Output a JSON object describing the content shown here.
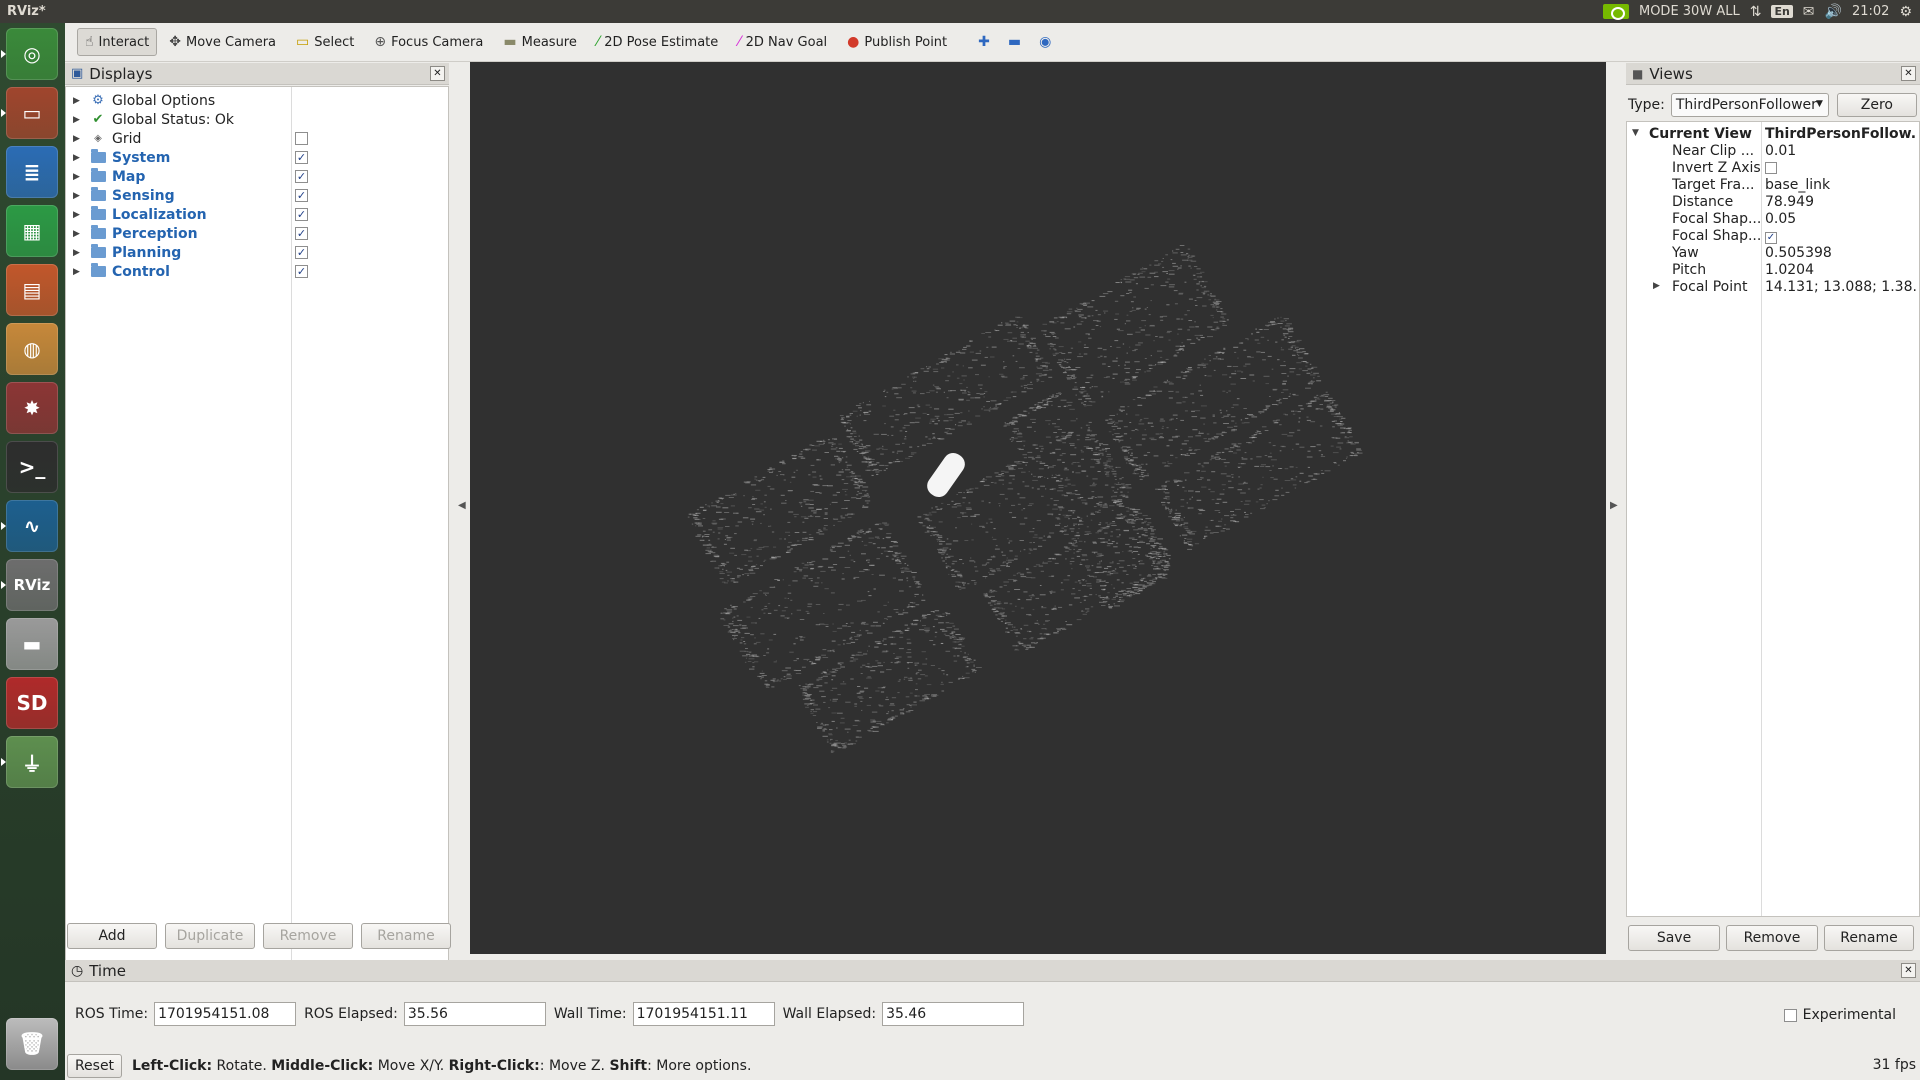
{
  "window": {
    "title": "RViz*"
  },
  "system_tray": {
    "power_mode": "MODE 30W ALL",
    "keyboard_layout": "En",
    "clock": "21:02"
  },
  "launcher": {
    "items": [
      {
        "name": "ubuntu-dash",
        "glyph": "◎",
        "color": "#3a8a3a"
      },
      {
        "name": "files",
        "glyph": "▭",
        "color": "#a0452d"
      },
      {
        "name": "writer",
        "glyph": "≣",
        "color": "#2b6cb5"
      },
      {
        "name": "calc",
        "glyph": "▦",
        "color": "#2c9a45"
      },
      {
        "name": "impress",
        "glyph": "▤",
        "color": "#c2572b"
      },
      {
        "name": "software-center",
        "glyph": "◍",
        "color": "#c7883a"
      },
      {
        "name": "system-settings",
        "glyph": "✸",
        "color": "#8c3535"
      },
      {
        "name": "terminal",
        "glyph": ">_",
        "color": "#2d2d2d"
      },
      {
        "name": "autoware",
        "glyph": "∿",
        "color": "#1d5f8f"
      },
      {
        "name": "rviz",
        "glyph": "RViz",
        "color": "#6d6d6d"
      },
      {
        "name": "drive",
        "glyph": "▬",
        "color": "#9a9a9a"
      },
      {
        "name": "sd-card",
        "glyph": "SD",
        "color": "#b02a2a"
      },
      {
        "name": "usb-drive",
        "glyph": "⏚",
        "color": "#5e8f4f"
      }
    ],
    "trash_glyph": "🗑"
  },
  "toolbar": {
    "tools": [
      {
        "label": "Interact",
        "icon": "☝",
        "icon_name": "hand-icon",
        "color": "#444",
        "active": true
      },
      {
        "label": "Move Camera",
        "icon": "✥",
        "icon_name": "move-camera-icon",
        "color": "#444"
      },
      {
        "label": "Select",
        "icon": "▭",
        "icon_name": "select-icon",
        "color": "#c59d00"
      },
      {
        "label": "Focus Camera",
        "icon": "⊕",
        "icon_name": "focus-camera-icon",
        "color": "#555"
      },
      {
        "label": "Measure",
        "icon": "▬",
        "icon_name": "ruler-icon",
        "color": "#8a8a6a"
      },
      {
        "label": "2D Pose Estimate",
        "icon": "⁄",
        "icon_name": "pose-estimate-arrow-icon",
        "color": "#2ea32e"
      },
      {
        "label": "2D Nav Goal",
        "icon": "⁄",
        "icon_name": "nav-goal-arrow-icon",
        "color": "#d82fd8"
      },
      {
        "label": "Publish Point",
        "icon": "●",
        "icon_name": "map-pin-icon",
        "color": "#d23a2a"
      }
    ],
    "extra": [
      {
        "icon": "✚",
        "icon_name": "add-tool-icon",
        "color": "#2e68c0"
      },
      {
        "icon": "▬",
        "icon_name": "remove-tool-icon",
        "color": "#2e68c0"
      },
      {
        "icon": "◉",
        "icon_name": "eye-icon",
        "color": "#2e68c0"
      }
    ]
  },
  "displays": {
    "title": "Displays",
    "items": [
      {
        "label": "Global Options",
        "kind": "gear",
        "checkbox": null
      },
      {
        "label": "Global Status: Ok",
        "kind": "ok",
        "checkbox": null
      },
      {
        "label": "Grid",
        "kind": "grid",
        "checkbox": false
      },
      {
        "label": "System",
        "kind": "folder",
        "checkbox": true
      },
      {
        "label": "Map",
        "kind": "folder",
        "checkbox": true
      },
      {
        "label": "Sensing",
        "kind": "folder",
        "checkbox": true
      },
      {
        "label": "Localization",
        "kind": "folder",
        "checkbox": true
      },
      {
        "label": "Perception",
        "kind": "folder",
        "checkbox": true
      },
      {
        "label": "Planning",
        "kind": "folder",
        "checkbox": true
      },
      {
        "label": "Control",
        "kind": "folder",
        "checkbox": true
      }
    ],
    "buttons": {
      "add": "Add",
      "duplicate": "Duplicate",
      "remove": "Remove",
      "rename": "Rename"
    }
  },
  "views": {
    "title": "Views",
    "type_label": "Type:",
    "type_value": "ThirdPersonFollower",
    "zero_button": "Zero",
    "current_view": {
      "name": "Current View",
      "value": "ThirdPersonFollow..."
    },
    "properties": [
      {
        "name": "Near Clip ...",
        "value": "0.01",
        "kind": "text"
      },
      {
        "name": "Invert Z Axis",
        "value": "",
        "kind": "checkbox",
        "checked": false
      },
      {
        "name": "Target Fra...",
        "value": "base_link",
        "kind": "text"
      },
      {
        "name": "Distance",
        "value": "78.949",
        "kind": "text"
      },
      {
        "name": "Focal Shap...",
        "value": "0.05",
        "kind": "text"
      },
      {
        "name": "Focal Shap...",
        "value": "",
        "kind": "checkbox",
        "checked": true
      },
      {
        "name": "Yaw",
        "value": "0.505398",
        "kind": "text"
      },
      {
        "name": "Pitch",
        "value": "1.0204",
        "kind": "text"
      },
      {
        "name": "Focal Point",
        "value": "14.131; 13.088; 1.38...",
        "kind": "text",
        "expandable": true
      }
    ],
    "buttons": {
      "save": "Save",
      "remove": "Remove",
      "rename": "Rename"
    }
  },
  "time": {
    "title": "Time",
    "ros_time_label": "ROS Time:",
    "ros_time": "1701954151.08",
    "ros_elapsed_label": "ROS Elapsed:",
    "ros_elapsed": "35.56",
    "wall_time_label": "Wall Time:",
    "wall_time": "1701954151.11",
    "wall_elapsed_label": "Wall Elapsed:",
    "wall_elapsed": "35.46",
    "experimental_label": "Experimental"
  },
  "status": {
    "reset_button": "Reset",
    "parts": [
      {
        "bold": "Left-Click:",
        "text": " Rotate. "
      },
      {
        "bold": "Middle-Click:",
        "text": " Move X/Y. "
      },
      {
        "bold": "Right-Click:",
        "text": ": Move Z. "
      },
      {
        "bold": "Shift",
        "text": ": More options."
      }
    ],
    "fps": "31 fps"
  },
  "colors": {
    "viewport_bg": "#303030",
    "group_label": "#2464b0",
    "check": "#1f3e87"
  }
}
